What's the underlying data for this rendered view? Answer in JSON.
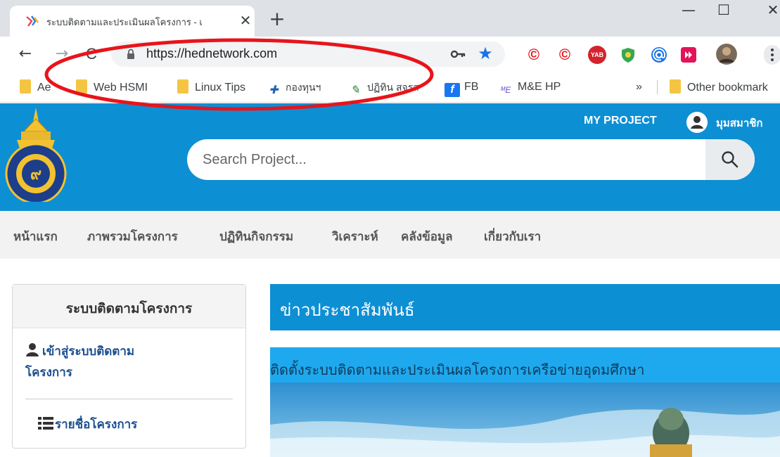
{
  "browser": {
    "tab": {
      "title": "ระบบติดตามและประเมินผลโครงการ - เ",
      "close_symbol": "✕"
    },
    "new_tab_symbol": "+",
    "window_controls": {
      "minimize": "—",
      "maximize": "☐",
      "close": "✕"
    },
    "address_bar": {
      "url": "https://hednetwork.com"
    },
    "nav": {
      "back": "←",
      "forward": "→",
      "reload": "C"
    },
    "extension_yab_label": "YAB",
    "bookmarks": [
      {
        "label": "Ae",
        "icon": "folder-icon"
      },
      {
        "label": "Web HSMI",
        "icon": "folder-icon"
      },
      {
        "label": "Linux Tips",
        "icon": "folder-icon"
      },
      {
        "label": "กองทุนฯ",
        "icon": "cross-icon"
      },
      {
        "label": "ปฏิทิน สจรส",
        "icon": "pen-icon"
      },
      {
        "label": "FB",
        "icon": "facebook-icon"
      },
      {
        "label": "M&E HP",
        "icon": "me-icon"
      }
    ],
    "bookmarks_overflow": "»",
    "other_bookmarks": "Other bookmark",
    "colors": {
      "star": "#1a73e8",
      "annotation": "#e8141b"
    }
  },
  "site": {
    "header": {
      "my_project": "MY PROJECT",
      "member": "มุมสมาชิก",
      "search_placeholder": "Search Project...",
      "color": "#0d8fd4"
    },
    "menu": [
      "หน้าแรก",
      "ภาพรวมโครงการ",
      "ปฏิทินกิจกรรม",
      "วิเคราะห์",
      "คลังข้อมูล",
      "เกี่ยวกับเรา"
    ],
    "sidebar": {
      "title": "ระบบติดตามโครงการ",
      "login_line1": "เข้าสู่ระบบติดตาม",
      "login_line2": "โครงการ",
      "project_list": "รายชื่อโครงการ"
    },
    "news": {
      "title": "ข่าวประชาสัมพันธ์",
      "headline": "ติดตั้งระบบติดตามและประเมินผลโครงการเครือข่ายอุดมศึกษา"
    }
  }
}
